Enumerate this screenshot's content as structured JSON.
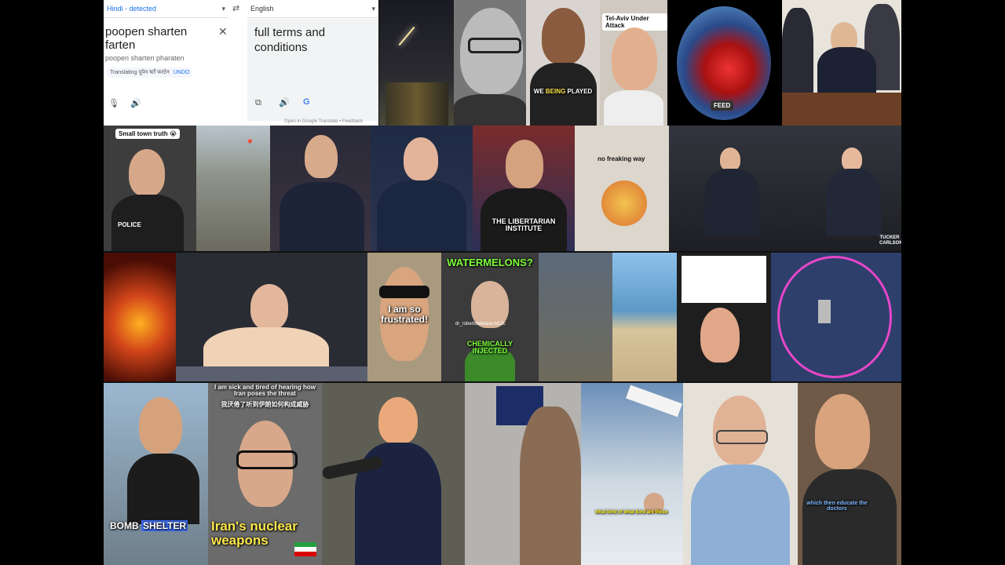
{
  "translate": {
    "source_lang": "Hindi - detected",
    "target_lang": "English",
    "source_text": "poopen sharten farten",
    "romanized": "poopen sharten pharaten",
    "translating_label": "Translating",
    "translating_text": "पूपेन षर्तें फरटेन",
    "undo_label": "UNDO",
    "result_text": "full terms and conditions",
    "footer_open": "Open in Google Translate",
    "footer_sep": "•",
    "footer_feedback": "Feedback"
  },
  "captions": {
    "tel_aviv": "Tel-Aviv Under Attack",
    "played_a": "WE",
    "played_b": "BEING",
    "played_c": "PLAYED",
    "feed": "FEED",
    "small_town": "Small town truth 😭",
    "police": "POLICE",
    "libertarian": "THE LIBERTARIAN INSTITUTE",
    "freaking": "no freaking way",
    "tucker": "TUCKER CARLSON",
    "frustrated": "I am so frustrated!",
    "watermelons": "WATERMELONS?",
    "chem": "CHEMICALLY INJECTED",
    "handle": "dr_robertdebease.nd.dc",
    "bomb_a": "BOMB",
    "bomb_b": "SHELTER",
    "sick": "I am sick and tired of hearing how Iran poses the threat",
    "sick_cn": "我厌倦了听到伊朗如何构成威胁",
    "iran_nuclear": "Iran's nuclear weapons",
    "educate": "which then educate the doctors",
    "unclear": "what kind of what kind are these"
  },
  "colors": {
    "accent": "#1a73e8",
    "caption_green": "#7dff3a",
    "caption_yellow": "#ffe84a"
  }
}
